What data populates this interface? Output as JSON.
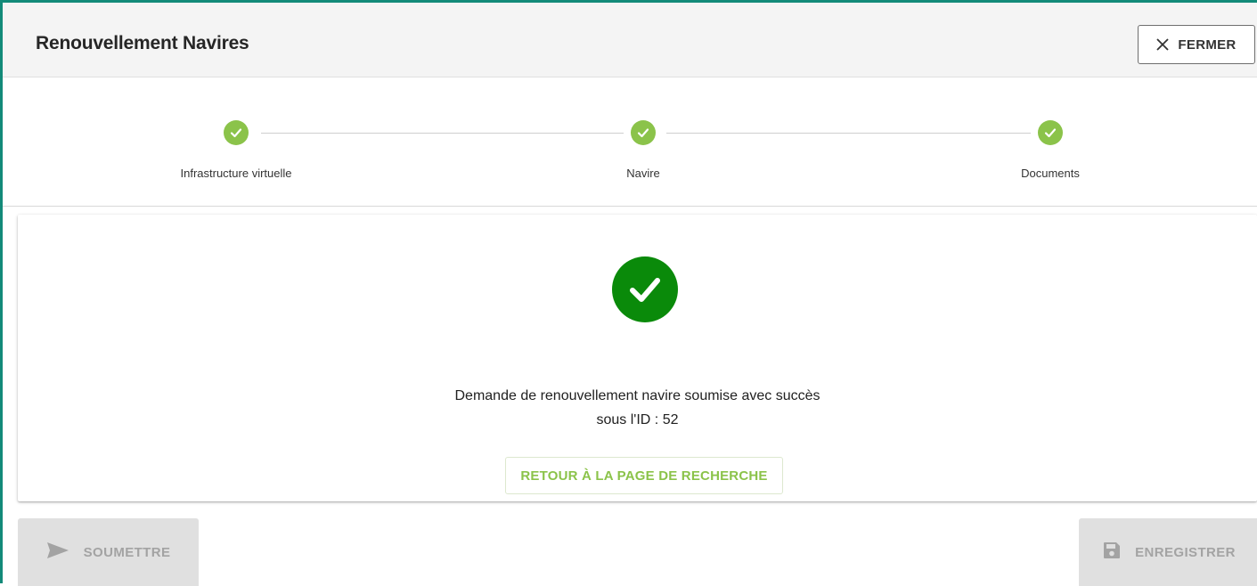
{
  "header": {
    "title": "Renouvellement Navires",
    "close_label": "FERMER"
  },
  "stepper": {
    "steps": [
      {
        "label": "Infrastructure virtuelle",
        "status": "completed"
      },
      {
        "label": "Navire",
        "status": "completed"
      },
      {
        "label": "Documents",
        "status": "completed"
      }
    ]
  },
  "result": {
    "message_line1": "Demande de renouvellement navire soumise avec succès",
    "message_line2": "sous l'ID : 52",
    "back_button_label": "RETOUR À LA PAGE DE RECHERCHE"
  },
  "footer": {
    "submit_label": "SOUMETTRE",
    "save_label": "ENREGISTRER"
  },
  "colors": {
    "frame_accent": "#138a79",
    "step_complete": "#8bc34a",
    "success": "#0a8a0a",
    "link_green": "#8bc34a"
  },
  "icons": {
    "close": "close-icon",
    "step_check": "check-icon",
    "success": "check-circle-icon",
    "submit": "send-icon",
    "save": "floppy-disk-icon"
  }
}
